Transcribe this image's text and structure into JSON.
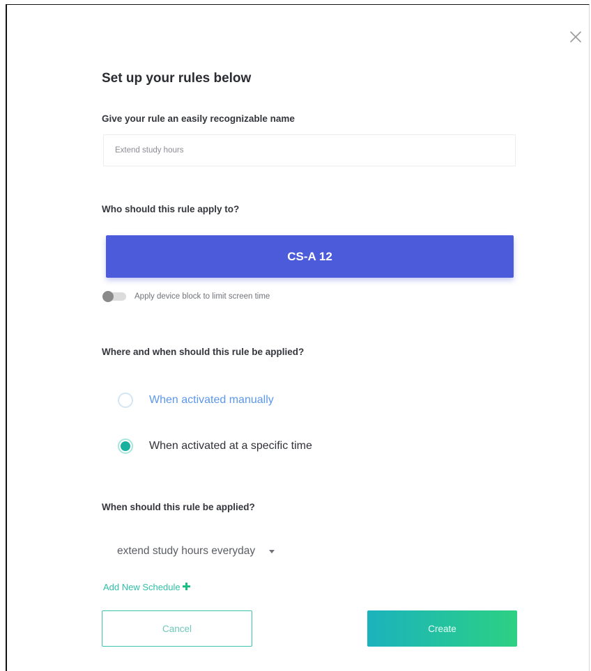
{
  "modal": {
    "heading": "Set up your rules below",
    "close_icon": "close-icon"
  },
  "rule_name": {
    "label": "Give your rule an easily recognizable name",
    "value": "Extend study hours"
  },
  "apply_to": {
    "label": "Who should this rule apply to?",
    "group_button": "CS-A 12",
    "group_color": "#4b5bd9"
  },
  "device_block": {
    "label": "Apply device block to limit screen time",
    "enabled": false
  },
  "where_when": {
    "label": "Where and when should this rule be applied?",
    "options": [
      {
        "label": "When activated manually",
        "selected": false
      },
      {
        "label": "When activated at a specific time",
        "selected": true
      }
    ]
  },
  "schedule": {
    "label": "When should this rule be applied?",
    "selected": "extend study hours everyday",
    "add_link": "Add New Schedule",
    "add_icon": "plus-icon"
  },
  "footer": {
    "cancel_label": "Cancel",
    "create_label": "Create",
    "accent": "#2fbfa6"
  }
}
